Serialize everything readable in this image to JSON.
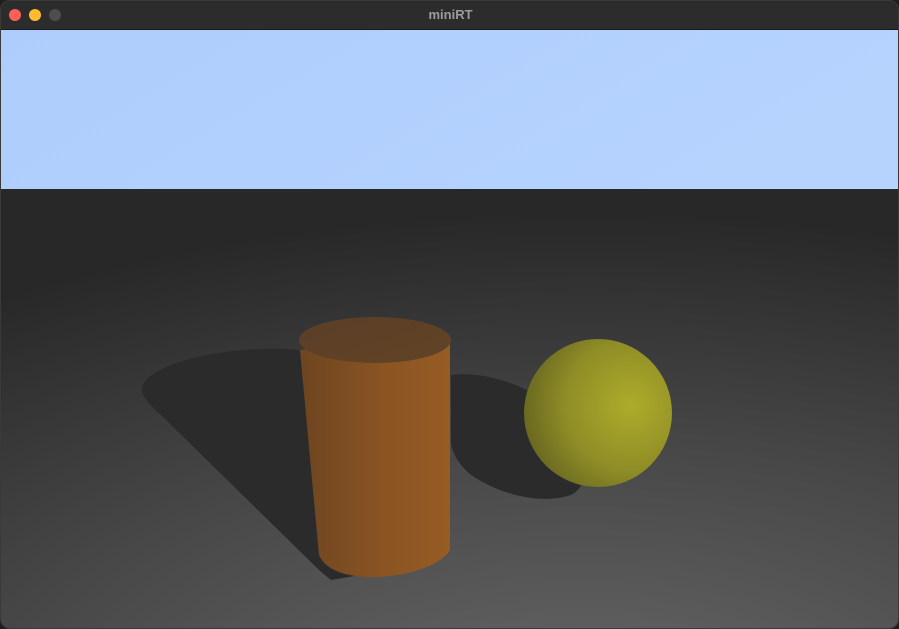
{
  "window": {
    "title": "miniRT",
    "buttons": [
      "close",
      "minimize",
      "maximize"
    ]
  },
  "colors": {
    "sky": "#b2d0fe",
    "floor_far": "#2a2a2a",
    "floor_near": "#5e5e5e",
    "shadow": "#2b2b2b",
    "cylinder": "#8a5220",
    "cylinder_cap": "#5c3f26",
    "sphere": "#a7a52a"
  },
  "scene": {
    "objects": [
      "plane",
      "cylinder",
      "sphere"
    ]
  }
}
